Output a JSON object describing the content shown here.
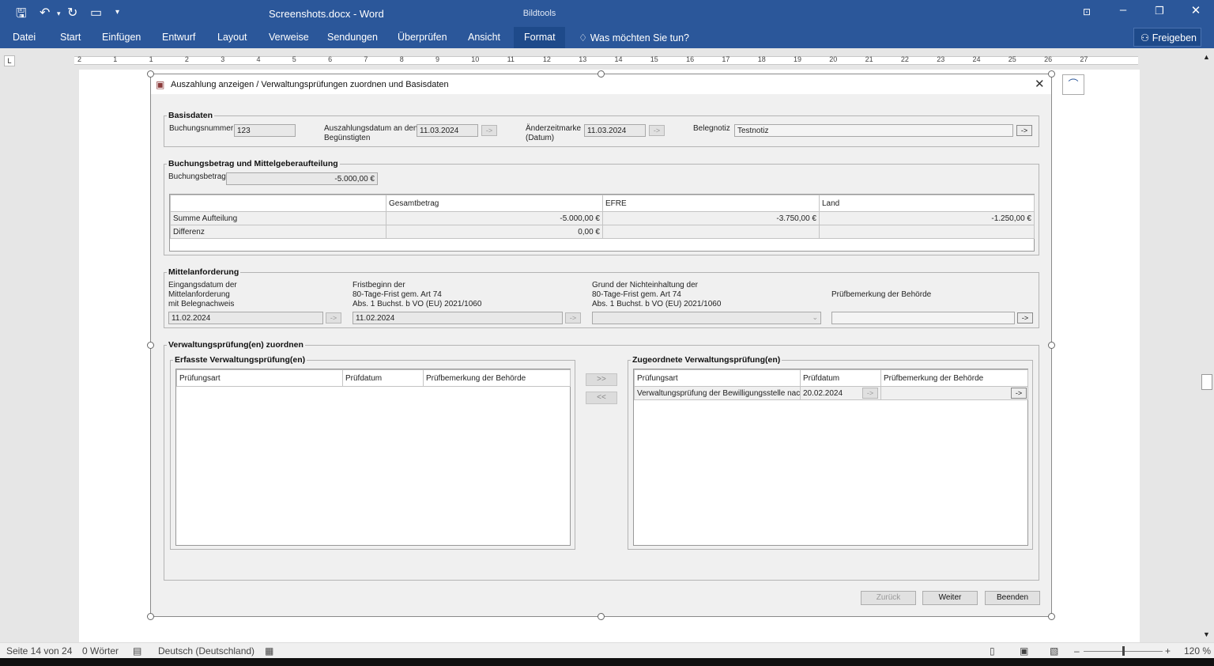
{
  "word": {
    "doc_title": "Screenshots.docx - Word",
    "context_tab": "Bildtools",
    "tabs": [
      "Datei",
      "Start",
      "Einfügen",
      "Entwurf",
      "Layout",
      "Verweise",
      "Sendungen",
      "Überprüfen",
      "Ansicht",
      "Format"
    ],
    "search_placeholder": "Was möchten Sie tun?",
    "share_label": "Freigeben",
    "ruler_numbers": [
      "2",
      "1",
      "1",
      "2",
      "3",
      "4",
      "5",
      "6",
      "7",
      "8",
      "9",
      "10",
      "11",
      "12",
      "13",
      "14",
      "15",
      "16",
      "17",
      "18",
      "19",
      "20",
      "21",
      "22",
      "23",
      "24",
      "25",
      "26",
      "27"
    ],
    "status": {
      "page": "Seite 14 von 24",
      "words": "0 Wörter",
      "language": "Deutsch (Deutschland)",
      "zoom": "120 %"
    }
  },
  "dialog": {
    "title": "Auszahlung anzeigen / Verwaltungsprüfungen zuordnen und Basisdaten",
    "basisdaten": {
      "legend": "Basisdaten",
      "buchungsnummer_label": "Buchungsnummer",
      "buchungsnummer": "123",
      "auszahlungsdatum_label_1": "Auszahlungsdatum an den",
      "auszahlungsdatum_label_2": "Begünstigten",
      "auszahlungsdatum": "11.03.2024",
      "aenderzeitmarke_label_1": "Änderzeitmarke",
      "aenderzeitmarke_label_2": "(Datum)",
      "aenderzeitmarke": "11.03.2024",
      "belegnotiz_label": "Belegnotiz",
      "belegnotiz": "Testnotiz",
      "arrow": "->"
    },
    "buchung": {
      "legend": "Buchungsbetrag und Mittelgeberaufteilung",
      "betrag_label": "Buchungsbetrag",
      "betrag": "-5.000,00 €",
      "columns": [
        "",
        "Gesamtbetrag",
        "EFRE",
        "Land"
      ],
      "rows": [
        [
          "Summe Aufteilung",
          "-5.000,00 €",
          "-3.750,00 €",
          "-1.250,00 €"
        ],
        [
          "Differenz",
          "0,00 €",
          "",
          ""
        ]
      ]
    },
    "mittel": {
      "legend": "Mittelanforderung",
      "eingang_label": [
        "Eingangsdatum der",
        "Mittelanforderung",
        "mit Belegnachweis"
      ],
      "eingang": "11.02.2024",
      "frist_label": [
        "Fristbeginn der",
        "80-Tage-Frist gem. Art 74",
        "Abs. 1 Buchst. b VO (EU) 2021/1060"
      ],
      "frist": "11.02.2024",
      "grund_label": [
        "Grund der Nichteinhaltung der",
        "80-Tage-Frist gem. Art 74",
        "Abs. 1 Buchst. b VO (EU) 2021/1060"
      ],
      "grund": "",
      "bemerkung_label": "Prüfbemerkung der Behörde",
      "bemerkung": ""
    },
    "vp": {
      "legend": "Verwaltungsprüfung(en) zuordnen",
      "erfasst_legend": "Erfasste Verwaltungsprüfung(en)",
      "zugeordnet_legend": "Zugeordnete Verwaltungsprüfung(en)",
      "columns": [
        "Prüfungsart",
        "Prüfdatum",
        "Prüfbemerkung der Behörde"
      ],
      "erfasst_rows": [],
      "zugeordnet_rows": [
        [
          "Verwaltungsprüfung der Bewilligungsstelle nach Art...",
          "20.02.2024",
          ""
        ]
      ],
      "add_label": ">>",
      "remove_label": "<<"
    },
    "buttons": {
      "back": "Zurück",
      "next": "Weiter",
      "finish": "Beenden"
    }
  }
}
